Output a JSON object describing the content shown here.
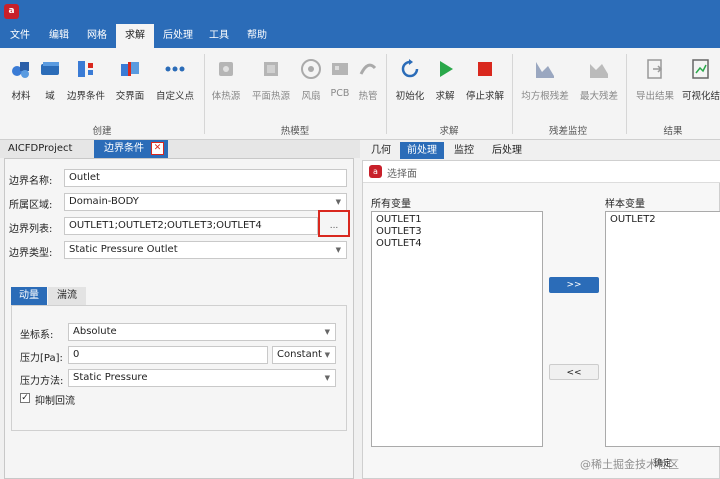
{
  "app": {
    "logo": "a"
  },
  "menu": [
    "文件",
    "编辑",
    "网格",
    "求解",
    "后处理",
    "工具",
    "帮助"
  ],
  "ribbon": {
    "create": {
      "label": "创建",
      "buttons": [
        "材料",
        "域",
        "边界条件",
        "交界面",
        "自定义点"
      ]
    },
    "heat": {
      "label": "热模型",
      "buttons": [
        "体热源",
        "平面热源",
        "风扇",
        "PCB",
        "热管"
      ]
    },
    "solve": {
      "label": "求解",
      "buttons": [
        "初始化",
        "求解",
        "停止求解"
      ]
    },
    "residual": {
      "label": "残差监控",
      "buttons": [
        "均方根残差",
        "最大残差"
      ]
    },
    "result": {
      "label": "结果",
      "buttons": [
        "导出结果",
        "可视化结"
      ]
    }
  },
  "doctabs": {
    "project": "AICFDProject",
    "boundary": "边界条件",
    "close": "✕"
  },
  "boundary": {
    "name_label": "边界名称:",
    "name_value": "Outlet",
    "region_label": "所属区域:",
    "region_value": "Domain-BODY",
    "list_label": "边界列表:",
    "list_value": "OUTLET1;OUTLET2;OUTLET3;OUTLET4",
    "list_button": "...",
    "type_label": "边界类型:",
    "type_value": "Static Pressure Outlet"
  },
  "subtabs": [
    "动量",
    "湍流"
  ],
  "momentum": {
    "coord_label": "坐标系:",
    "coord_value": "Absolute",
    "pressure_label": "压力[Pa]:",
    "pressure_value": "0",
    "pressure_mode": "Constant",
    "method_label": "压力方法:",
    "method_value": "Static Pressure",
    "backflow_label": "抑制回流",
    "backflow_checked": true
  },
  "righttabs": [
    "几何",
    "前处理",
    "监控",
    "后处理"
  ],
  "dialog": {
    "title": "选择面",
    "all_label": "所有变量",
    "all_items": [
      "OUTLET1",
      "OUTLET3",
      "OUTLET4"
    ],
    "sample_label": "样本变量",
    "sample_items": [
      "OUTLET2"
    ],
    "add_button": ">>",
    "remove_button": "<<",
    "confirm_button": "确定"
  },
  "watermark": "@稀土掘金技术社区",
  "colors": {
    "accent": "#2b6cb8",
    "highlight": "#d9281e"
  }
}
